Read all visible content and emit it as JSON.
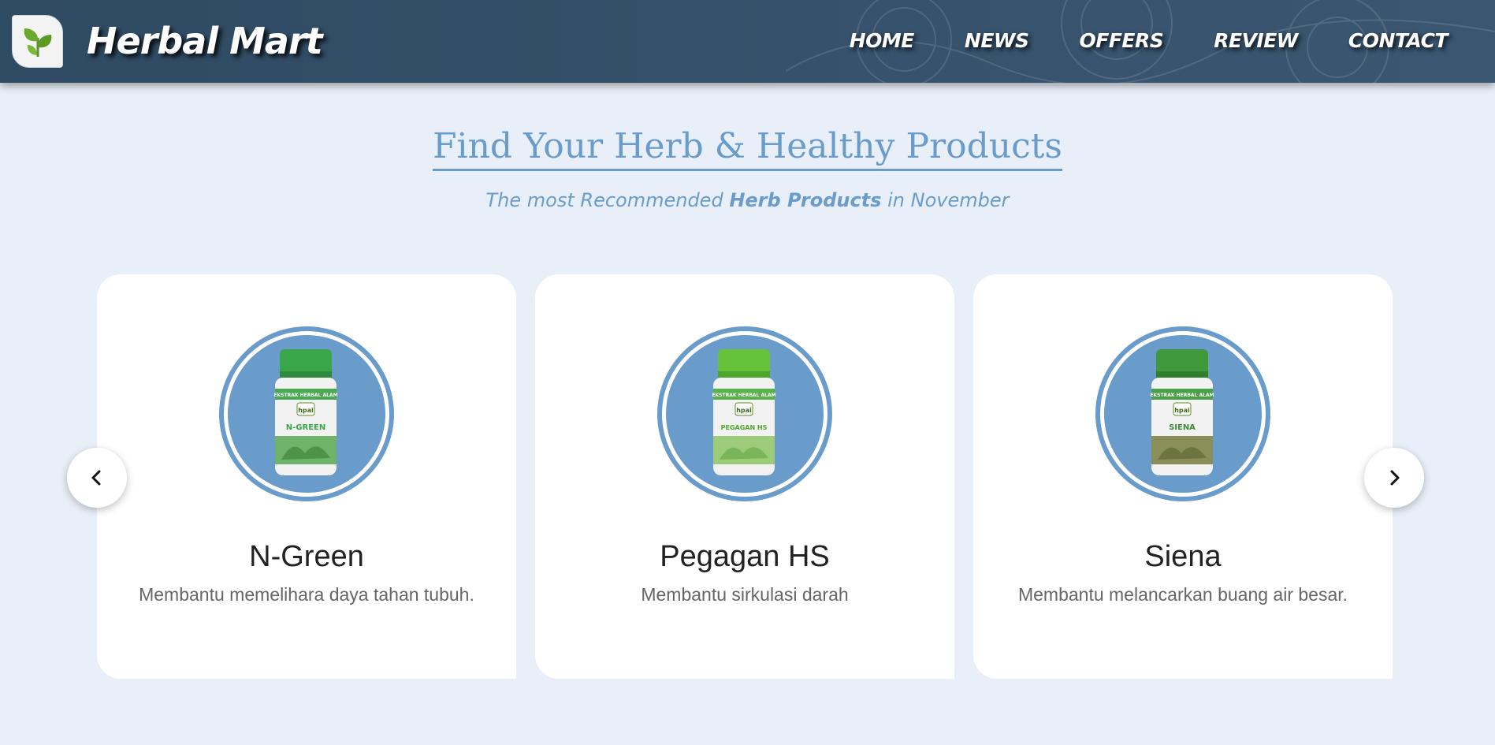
{
  "brand": {
    "name": "Herbal Mart",
    "logo_icon": "leaf-sprout-icon"
  },
  "nav": {
    "items": [
      {
        "label": "HOME"
      },
      {
        "label": "NEWS"
      },
      {
        "label": "OFFERS"
      },
      {
        "label": "REVIEW"
      },
      {
        "label": "CONTACT"
      }
    ]
  },
  "section": {
    "title": "Find Your Herb & Healthy Products",
    "subtitle_prefix": "The most Recommended ",
    "subtitle_bold": "Herb Products",
    "subtitle_suffix": " in November"
  },
  "products": [
    {
      "name": "N-Green",
      "description": "Membantu memelihara daya tahan tubuh.",
      "label": "N-GREEN",
      "brand_band": "EKSTRAK HERBAL ALAM",
      "maker": "hpai"
    },
    {
      "name": "Pegagan HS",
      "description": "Membantu sirkulasi darah",
      "label": "PEGAGAN HS",
      "brand_band": "EKSTRAK HERBAL ALAM",
      "maker": "hpai"
    },
    {
      "name": "Siena",
      "description": "Membantu melancarkan buang air besar.",
      "label": "SIENA",
      "brand_band": "EKSTRAK HERBAL ALAM",
      "maker": "hpai"
    }
  ],
  "carousel": {
    "prev_icon": "chevron-left-icon",
    "next_icon": "chevron-right-icon"
  },
  "colors": {
    "accent": "#6a9ccb",
    "header": "#36526c",
    "background": "#e8eff8",
    "bottle_cap": "#3aa64a"
  }
}
